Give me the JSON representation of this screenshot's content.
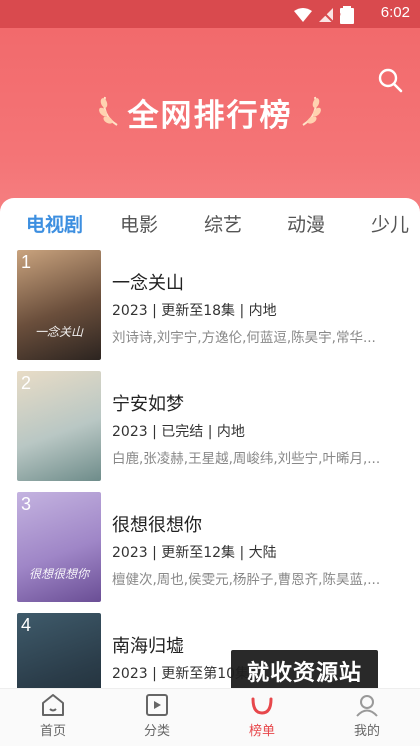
{
  "status": {
    "time": "6:02",
    "battery": "6"
  },
  "header": {
    "title": "全网排行榜"
  },
  "tabs": [
    {
      "label": "电视剧",
      "active": true
    },
    {
      "label": "电影",
      "active": false
    },
    {
      "label": "综艺",
      "active": false
    },
    {
      "label": "动漫",
      "active": false
    },
    {
      "label": "少儿",
      "active": false
    }
  ],
  "items": [
    {
      "rank": "1",
      "title": "一念关山",
      "meta": "2023 | 更新至18集 | 内地",
      "cast": "刘诗诗,刘宇宁,方逸伦,何蓝逗,陈昊宇,常华...",
      "poster_text": "一念关山",
      "colors": [
        "#c9a37e",
        "#6b4f3c",
        "#2c2420"
      ]
    },
    {
      "rank": "2",
      "title": "宁安如梦",
      "meta": "2023 | 已完结 | 内地",
      "cast": "白鹿,张凌赫,王星越,周峻纬,刘些宁,叶晞月,...",
      "poster_text": "",
      "colors": [
        "#e8dcc6",
        "#b9c7c4",
        "#6e8c8a"
      ]
    },
    {
      "rank": "3",
      "title": "很想很想你",
      "meta": "2023 | 更新至12集 | 大陆",
      "cast": "檀健次,周也,侯雯元,杨肸子,曹恩齐,陈昊蓝,...",
      "poster_text": "很想很想你",
      "colors": [
        "#c4b3e0",
        "#9f86c7",
        "#6a4e95"
      ]
    },
    {
      "rank": "4",
      "title": "南海归墟",
      "meta": "2023 | 更新至第10集",
      "cast": "",
      "poster_text": "",
      "colors": [
        "#3f5b6b",
        "#2b3d4a",
        "#1d2a33"
      ]
    }
  ],
  "nav": [
    {
      "label": "首页",
      "icon": "home-icon",
      "active": false
    },
    {
      "label": "分类",
      "icon": "category-icon",
      "active": false
    },
    {
      "label": "榜单",
      "icon": "ranking-icon",
      "active": true
    },
    {
      "label": "我的",
      "icon": "profile-icon",
      "active": false
    }
  ],
  "watermark": "就收资源站",
  "colors": {
    "brand": "#f26a6c",
    "tab_active": "#3d8fe0",
    "nav_active": "#e7474b"
  }
}
